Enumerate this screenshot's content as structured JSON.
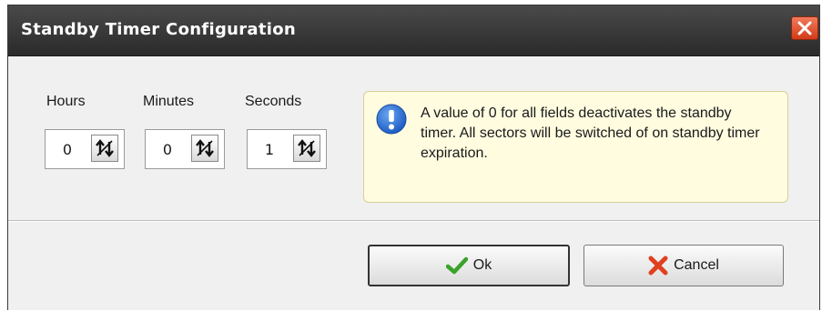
{
  "window": {
    "title": "Standby Timer Configuration",
    "close_icon": "close-icon"
  },
  "fields": [
    {
      "label": "Hours",
      "value": "0"
    },
    {
      "label": "Minutes",
      "value": "0"
    },
    {
      "label": "Seconds",
      "value": "1"
    }
  ],
  "info": {
    "icon": "info-icon",
    "text": "A value of 0 for all fields deactivates the standby timer. All sectors will be switched of on standby timer expiration."
  },
  "buttons": {
    "ok_label": "Ok",
    "ok_icon": "checkmark-icon",
    "cancel_label": "Cancel",
    "cancel_icon": "x-icon"
  },
  "colors": {
    "titlebar": "#333333",
    "info_background": "#fffce0",
    "info_icon": "#2a6fd6",
    "check": "#3aa32a",
    "cancel_x": "#e0401e"
  }
}
